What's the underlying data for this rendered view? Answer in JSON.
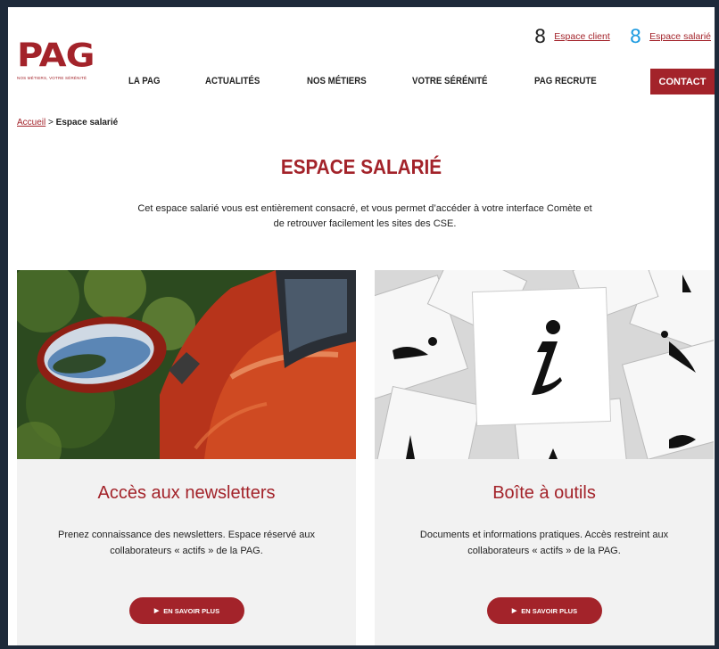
{
  "brand": {
    "logo_text": "PAG",
    "tagline": "NOS MÉTIERS, VOTRE SÉRÉNITÉ",
    "accent_color": "#a3232a"
  },
  "top_links": [
    {
      "icon": "person-icon",
      "glyph": "8",
      "label": "Espace client"
    },
    {
      "icon": "person-icon-blue",
      "glyph": "8",
      "label": "Espace salarié"
    }
  ],
  "nav": {
    "items": [
      "LA PAG",
      "ACTUALITÉS",
      "NOS MÉTIERS",
      "VOTRE SÉRÉNITÉ",
      "PAG RECRUTE"
    ],
    "contact": "CONTACT"
  },
  "breadcrumb": {
    "home": "Accueil",
    "separator": " > ",
    "current": "Espace salarié"
  },
  "page": {
    "title": "ESPACE SALARIÉ",
    "intro": "Cet espace salarié vous est entièrement consacré, et vous permet d’accéder à votre interface Comète et de retrouver facilement les sites des CSE."
  },
  "cards": [
    {
      "image": "car-mirror-photo",
      "title": "Accès aux newsletters",
      "description": "Prenez connaissance des newsletters. Espace réservé aux collaborateurs « actifs » de la PAG.",
      "button": "EN SAVOIR PLUS"
    },
    {
      "image": "info-cards-photo",
      "title": "Boîte à outils",
      "description": "Documents et informations pratiques. Accès restreint aux collaborateurs « actifs » de la PAG.",
      "button": "EN SAVOIR PLUS"
    }
  ]
}
